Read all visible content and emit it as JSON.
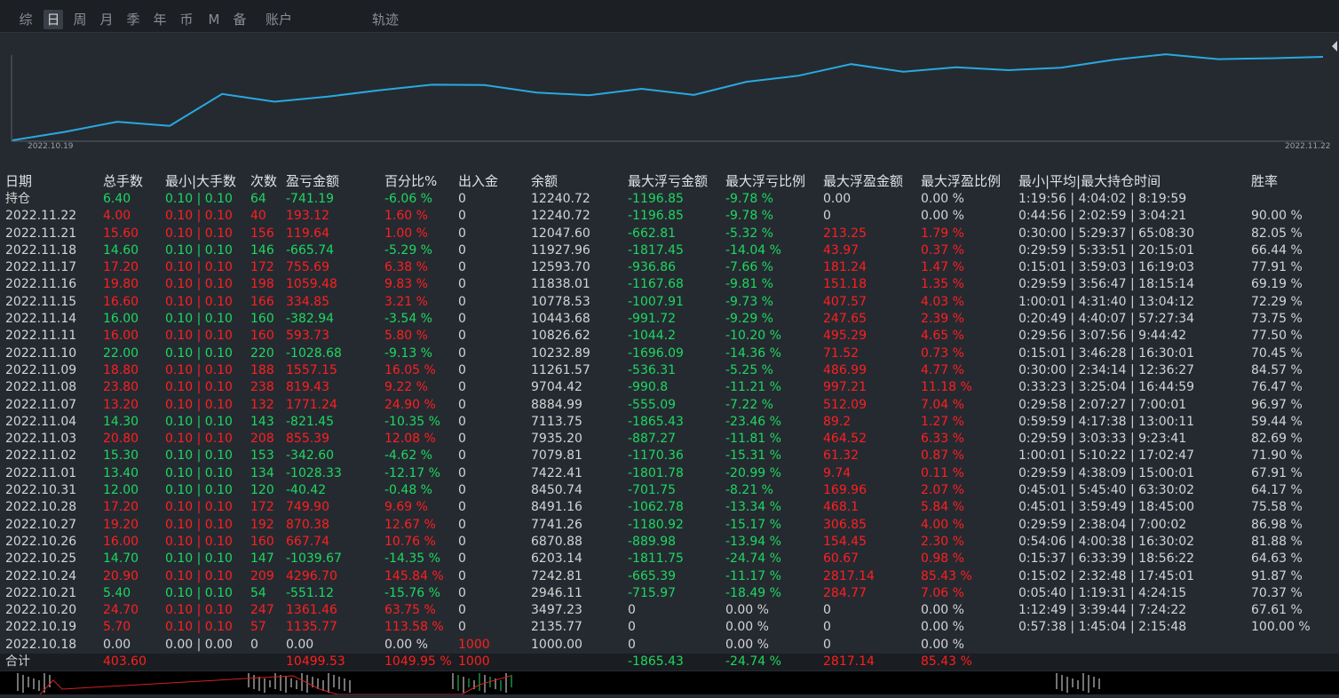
{
  "tabs": [
    "综",
    "日",
    "周",
    "月",
    "季",
    "年",
    "币",
    "M",
    "备",
    "账户",
    "轨迹"
  ],
  "active_tab": "日",
  "chart": {
    "start_label": "2022.10.19",
    "end_label": "2022.11.22",
    "line_color": "#29a9e0"
  },
  "chart_data": {
    "type": "line",
    "x": [
      "2022.10.18",
      "2022.10.19",
      "2022.10.20",
      "2022.10.21",
      "2022.10.24",
      "2022.10.25",
      "2022.10.26",
      "2022.10.27",
      "2022.10.28",
      "2022.10.31",
      "2022.11.01",
      "2022.11.02",
      "2022.11.03",
      "2022.11.04",
      "2022.11.07",
      "2022.11.08",
      "2022.11.09",
      "2022.11.10",
      "2022.11.11",
      "2022.11.14",
      "2022.11.15",
      "2022.11.16",
      "2022.11.17",
      "2022.11.18",
      "2022.11.21",
      "2022.11.22"
    ],
    "y": [
      1000.0,
      2135.77,
      3497.23,
      2946.11,
      7242.81,
      6203.14,
      6870.88,
      7741.26,
      8491.16,
      8450.74,
      7422.41,
      7079.81,
      7935.2,
      7113.75,
      8884.99,
      9704.42,
      11261.57,
      10232.89,
      10826.62,
      10443.68,
      10778.53,
      11838.01,
      12593.7,
      11927.96,
      12047.6,
      12240.72
    ]
  },
  "headers": [
    "日期",
    "总手数",
    "最小|大手数",
    "次数",
    "盈亏金额",
    "百分比%",
    "出入金",
    "余额",
    "最大浮亏金额",
    "最大浮亏比例",
    "最大浮盈金额",
    "最大浮盈比例",
    "最小|平均|最大持仓时间",
    "胜率"
  ],
  "rows": [
    {
      "date": "持仓",
      "lots": "6.40",
      "minmax": "0.10 | 0.10",
      "count": "64",
      "pnl": "-741.19",
      "pct": "-6.06 %",
      "flow": "0",
      "bal": "12240.72",
      "mdd": "-1196.85",
      "mddp": "-9.78 %",
      "mfp": "0.00",
      "mfpp": "0.00 %",
      "time": "1:19:56 | 4:04:02 | 8:19:59",
      "win": "",
      "c": "g",
      "fc": "w",
      "fpc": "w"
    },
    {
      "date": "2022.11.22",
      "lots": "4.00",
      "minmax": "0.10 | 0.10",
      "count": "40",
      "pnl": "193.12",
      "pct": "1.60 %",
      "flow": "0",
      "bal": "12240.72",
      "mdd": "-1196.85",
      "mddp": "-9.78 %",
      "mfp": "0",
      "mfpp": "0.00 %",
      "time": "0:44:56 | 2:02:59 | 3:04:21",
      "win": "90.00 %",
      "c": "r",
      "fc": "w",
      "fpc": "w"
    },
    {
      "date": "2022.11.21",
      "lots": "15.60",
      "minmax": "0.10 | 0.10",
      "count": "156",
      "pnl": "119.64",
      "pct": "1.00 %",
      "flow": "0",
      "bal": "12047.60",
      "mdd": "-662.81",
      "mddp": "-5.32 %",
      "mfp": "213.25",
      "mfpp": "1.79 %",
      "time": "0:30:00 | 5:29:37 | 65:08:30",
      "win": "82.05 %",
      "c": "r",
      "fc": "r",
      "fpc": "r"
    },
    {
      "date": "2022.11.18",
      "lots": "14.60",
      "minmax": "0.10 | 0.10",
      "count": "146",
      "pnl": "-665.74",
      "pct": "-5.29 %",
      "flow": "0",
      "bal": "11927.96",
      "mdd": "-1817.45",
      "mddp": "-14.04 %",
      "mfp": "43.97",
      "mfpp": "0.37 %",
      "time": "0:29:59 | 5:33:51 | 20:15:01",
      "win": "66.44 %",
      "c": "g",
      "fc": "r",
      "fpc": "r"
    },
    {
      "date": "2022.11.17",
      "lots": "17.20",
      "minmax": "0.10 | 0.10",
      "count": "172",
      "pnl": "755.69",
      "pct": "6.38 %",
      "flow": "0",
      "bal": "12593.70",
      "mdd": "-936.86",
      "mddp": "-7.66 %",
      "mfp": "181.24",
      "mfpp": "1.47 %",
      "time": "0:15:01 | 3:59:03 | 16:19:03",
      "win": "77.91 %",
      "c": "r",
      "fc": "r",
      "fpc": "r"
    },
    {
      "date": "2022.11.16",
      "lots": "19.80",
      "minmax": "0.10 | 0.10",
      "count": "198",
      "pnl": "1059.48",
      "pct": "9.83 %",
      "flow": "0",
      "bal": "11838.01",
      "mdd": "-1167.68",
      "mddp": "-9.81 %",
      "mfp": "151.18",
      "mfpp": "1.35 %",
      "time": "0:29:59 | 3:56:47 | 18:15:14",
      "win": "69.19 %",
      "c": "r",
      "fc": "r",
      "fpc": "r"
    },
    {
      "date": "2022.11.15",
      "lots": "16.60",
      "minmax": "0.10 | 0.10",
      "count": "166",
      "pnl": "334.85",
      "pct": "3.21 %",
      "flow": "0",
      "bal": "10778.53",
      "mdd": "-1007.91",
      "mddp": "-9.73 %",
      "mfp": "407.57",
      "mfpp": "4.03 %",
      "time": "1:00:01 | 4:31:40 | 13:04:12",
      "win": "72.29 %",
      "c": "r",
      "fc": "r",
      "fpc": "r"
    },
    {
      "date": "2022.11.14",
      "lots": "16.00",
      "minmax": "0.10 | 0.10",
      "count": "160",
      "pnl": "-382.94",
      "pct": "-3.54 %",
      "flow": "0",
      "bal": "10443.68",
      "mdd": "-991.72",
      "mddp": "-9.29 %",
      "mfp": "247.65",
      "mfpp": "2.39 %",
      "time": "0:20:49 | 4:40:07 | 57:27:34",
      "win": "73.75 %",
      "c": "g",
      "fc": "r",
      "fpc": "r"
    },
    {
      "date": "2022.11.11",
      "lots": "16.00",
      "minmax": "0.10 | 0.10",
      "count": "160",
      "pnl": "593.73",
      "pct": "5.80 %",
      "flow": "0",
      "bal": "10826.62",
      "mdd": "-1044.2",
      "mddp": "-10.20 %",
      "mfp": "495.29",
      "mfpp": "4.65 %",
      "time": "0:29:56 | 3:07:56 | 9:44:42",
      "win": "77.50 %",
      "c": "r",
      "fc": "r",
      "fpc": "r"
    },
    {
      "date": "2022.11.10",
      "lots": "22.00",
      "minmax": "0.10 | 0.10",
      "count": "220",
      "pnl": "-1028.68",
      "pct": "-9.13 %",
      "flow": "0",
      "bal": "10232.89",
      "mdd": "-1696.09",
      "mddp": "-14.36 %",
      "mfp": "71.52",
      "mfpp": "0.73 %",
      "time": "0:15:01 | 3:46:28 | 16:30:01",
      "win": "70.45 %",
      "c": "g",
      "fc": "r",
      "fpc": "r"
    },
    {
      "date": "2022.11.09",
      "lots": "18.80",
      "minmax": "0.10 | 0.10",
      "count": "188",
      "pnl": "1557.15",
      "pct": "16.05 %",
      "flow": "0",
      "bal": "11261.57",
      "mdd": "-536.31",
      "mddp": "-5.25 %",
      "mfp": "486.99",
      "mfpp": "4.77 %",
      "time": "0:30:00 | 2:34:14 | 12:36:27",
      "win": "84.57 %",
      "c": "r",
      "fc": "r",
      "fpc": "r"
    },
    {
      "date": "2022.11.08",
      "lots": "23.80",
      "minmax": "0.10 | 0.10",
      "count": "238",
      "pnl": "819.43",
      "pct": "9.22 %",
      "flow": "0",
      "bal": "9704.42",
      "mdd": "-990.8",
      "mddp": "-11.21 %",
      "mfp": "997.21",
      "mfpp": "11.18 %",
      "time": "0:33:23 | 3:25:04 | 16:44:59",
      "win": "76.47 %",
      "c": "r",
      "fc": "r",
      "fpc": "r"
    },
    {
      "date": "2022.11.07",
      "lots": "13.20",
      "minmax": "0.10 | 0.10",
      "count": "132",
      "pnl": "1771.24",
      "pct": "24.90 %",
      "flow": "0",
      "bal": "8884.99",
      "mdd": "-555.09",
      "mddp": "-7.22 %",
      "mfp": "512.09",
      "mfpp": "7.04 %",
      "time": "0:29:58 | 2:07:27 | 7:00:01",
      "win": "96.97 %",
      "c": "r",
      "fc": "r",
      "fpc": "r"
    },
    {
      "date": "2022.11.04",
      "lots": "14.30",
      "minmax": "0.10 | 0.10",
      "count": "143",
      "pnl": "-821.45",
      "pct": "-10.35 %",
      "flow": "0",
      "bal": "7113.75",
      "mdd": "-1865.43",
      "mddp": "-23.46 %",
      "mfp": "89.2",
      "mfpp": "1.27 %",
      "time": "0:59:59 | 4:17:38 | 13:00:11",
      "win": "59.44 %",
      "c": "g",
      "fc": "r",
      "fpc": "r"
    },
    {
      "date": "2022.11.03",
      "lots": "20.80",
      "minmax": "0.10 | 0.10",
      "count": "208",
      "pnl": "855.39",
      "pct": "12.08 %",
      "flow": "0",
      "bal": "7935.20",
      "mdd": "-887.27",
      "mddp": "-11.81 %",
      "mfp": "464.52",
      "mfpp": "6.33 %",
      "time": "0:29:59 | 3:03:33 | 9:23:41",
      "win": "82.69 %",
      "c": "r",
      "fc": "r",
      "fpc": "r"
    },
    {
      "date": "2022.11.02",
      "lots": "15.30",
      "minmax": "0.10 | 0.10",
      "count": "153",
      "pnl": "-342.60",
      "pct": "-4.62 %",
      "flow": "0",
      "bal": "7079.81",
      "mdd": "-1170.36",
      "mddp": "-15.31 %",
      "mfp": "61.32",
      "mfpp": "0.87 %",
      "time": "1:00:01 | 5:10:22 | 17:02:47",
      "win": "71.90 %",
      "c": "g",
      "fc": "r",
      "fpc": "r"
    },
    {
      "date": "2022.11.01",
      "lots": "13.40",
      "minmax": "0.10 | 0.10",
      "count": "134",
      "pnl": "-1028.33",
      "pct": "-12.17 %",
      "flow": "0",
      "bal": "7422.41",
      "mdd": "-1801.78",
      "mddp": "-20.99 %",
      "mfp": "9.74",
      "mfpp": "0.11 %",
      "time": "0:29:59 | 4:38:09 | 15:00:01",
      "win": "67.91 %",
      "c": "g",
      "fc": "r",
      "fpc": "r"
    },
    {
      "date": "2022.10.31",
      "lots": "12.00",
      "minmax": "0.10 | 0.10",
      "count": "120",
      "pnl": "-40.42",
      "pct": "-0.48 %",
      "flow": "0",
      "bal": "8450.74",
      "mdd": "-701.75",
      "mddp": "-8.21 %",
      "mfp": "169.96",
      "mfpp": "2.07 %",
      "time": "0:45:01 | 5:45:40 | 63:30:02",
      "win": "64.17 %",
      "c": "g",
      "fc": "r",
      "fpc": "r"
    },
    {
      "date": "2022.10.28",
      "lots": "17.20",
      "minmax": "0.10 | 0.10",
      "count": "172",
      "pnl": "749.90",
      "pct": "9.69 %",
      "flow": "0",
      "bal": "8491.16",
      "mdd": "-1062.78",
      "mddp": "-13.34 %",
      "mfp": "468.1",
      "mfpp": "5.84 %",
      "time": "0:45:01 | 3:59:49 | 18:45:00",
      "win": "75.58 %",
      "c": "r",
      "fc": "r",
      "fpc": "r"
    },
    {
      "date": "2022.10.27",
      "lots": "19.20",
      "minmax": "0.10 | 0.10",
      "count": "192",
      "pnl": "870.38",
      "pct": "12.67 %",
      "flow": "0",
      "bal": "7741.26",
      "mdd": "-1180.92",
      "mddp": "-15.17 %",
      "mfp": "306.85",
      "mfpp": "4.00 %",
      "time": "0:29:59 | 2:38:04 | 7:00:02",
      "win": "86.98 %",
      "c": "r",
      "fc": "r",
      "fpc": "r"
    },
    {
      "date": "2022.10.26",
      "lots": "16.00",
      "minmax": "0.10 | 0.10",
      "count": "160",
      "pnl": "667.74",
      "pct": "10.76 %",
      "flow": "0",
      "bal": "6870.88",
      "mdd": "-889.98",
      "mddp": "-13.94 %",
      "mfp": "154.45",
      "mfpp": "2.30 %",
      "time": "0:54:06 | 4:00:38 | 16:30:02",
      "win": "81.88 %",
      "c": "r",
      "fc": "r",
      "fpc": "r"
    },
    {
      "date": "2022.10.25",
      "lots": "14.70",
      "minmax": "0.10 | 0.10",
      "count": "147",
      "pnl": "-1039.67",
      "pct": "-14.35 %",
      "flow": "0",
      "bal": "6203.14",
      "mdd": "-1811.75",
      "mddp": "-24.74 %",
      "mfp": "60.67",
      "mfpp": "0.98 %",
      "time": "0:15:37 | 6:33:39 | 18:56:22",
      "win": "64.63 %",
      "c": "g",
      "fc": "r",
      "fpc": "r"
    },
    {
      "date": "2022.10.24",
      "lots": "20.90",
      "minmax": "0.10 | 0.10",
      "count": "209",
      "pnl": "4296.70",
      "pct": "145.84 %",
      "flow": "0",
      "bal": "7242.81",
      "mdd": "-665.39",
      "mddp": "-11.17 %",
      "mfp": "2817.14",
      "mfpp": "85.43 %",
      "time": "0:15:02 | 2:32:48 | 17:45:01",
      "win": "91.87 %",
      "c": "r",
      "fc": "r",
      "fpc": "r"
    },
    {
      "date": "2022.10.21",
      "lots": "5.40",
      "minmax": "0.10 | 0.10",
      "count": "54",
      "pnl": "-551.12",
      "pct": "-15.76 %",
      "flow": "0",
      "bal": "2946.11",
      "mdd": "-715.97",
      "mddp": "-18.49 %",
      "mfp": "284.77",
      "mfpp": "7.06 %",
      "time": "0:05:40 | 1:19:31 | 4:24:15",
      "win": "70.37 %",
      "c": "g",
      "fc": "r",
      "fpc": "r"
    },
    {
      "date": "2022.10.20",
      "lots": "24.70",
      "minmax": "0.10 | 0.10",
      "count": "247",
      "pnl": "1361.46",
      "pct": "63.75 %",
      "flow": "0",
      "bal": "3497.23",
      "mdd": "0",
      "mddp": "0.00 %",
      "mfp": "0",
      "mfpp": "0.00 %",
      "time": "1:12:49 | 3:39:44 | 7:24:22",
      "win": "67.61 %",
      "c": "r",
      "fc": "w",
      "fpc": "w",
      "ddc": "w"
    },
    {
      "date": "2022.10.19",
      "lots": "5.70",
      "minmax": "0.10 | 0.10",
      "count": "57",
      "pnl": "1135.77",
      "pct": "113.58 %",
      "flow": "0",
      "bal": "2135.77",
      "mdd": "0",
      "mddp": "0.00 %",
      "mfp": "0",
      "mfpp": "0.00 %",
      "time": "0:57:38 | 1:45:04 | 2:15:48",
      "win": "100.00 %",
      "c": "r",
      "fc": "w",
      "fpc": "w",
      "ddc": "w"
    },
    {
      "date": "2022.10.18",
      "lots": "0.00",
      "minmax": "0.00 | 0.00",
      "count": "0",
      "pnl": "0.00",
      "pct": "0.00 %",
      "flow": "1000",
      "bal": "1000.00",
      "mdd": "0",
      "mddp": "0.00 %",
      "mfp": "0",
      "mfpp": "0.00 %",
      "time": "",
      "win": "",
      "c": "w",
      "fc": "w",
      "fpc": "w",
      "ddc": "w",
      "flowc": "r"
    }
  ],
  "total": {
    "label": "合计",
    "lots": "403.60",
    "pnl": "10499.53",
    "pct": "1049.95 %",
    "flow": "1000",
    "mdd": "-1865.43",
    "mddp": "-24.74 %",
    "mfp": "2817.14",
    "mfpp": "85.43 %"
  },
  "colors": {
    "profit": "#ff1f1f",
    "loss": "#1ed760",
    "neutral": "#d4d4d4",
    "background": "#252a31"
  }
}
